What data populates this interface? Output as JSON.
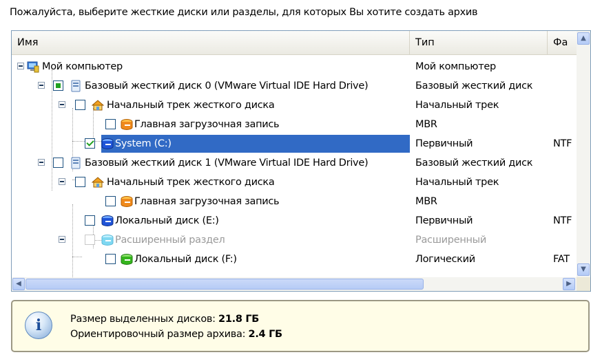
{
  "prompt": "Пожалуйста, выберите жесткие диски или разделы, для которых Вы хотите создать архив",
  "columns": {
    "name": "Имя",
    "type": "Тип",
    "fs": "Фа"
  },
  "rows": [
    {
      "label": "Мой компьютер",
      "type": "Мой компьютер",
      "fs": "",
      "icon": "computer-icon"
    },
    {
      "label": "Базовый жесткий диск 0 (VMware Virtual IDE Hard Drive)",
      "type": "Базовый жесткий диск",
      "fs": "",
      "icon": "hard-disk-icon"
    },
    {
      "label": "Начальный трек жесткого диска",
      "type": "Начальный трек",
      "fs": "",
      "icon": "track-icon"
    },
    {
      "label": "Главная загрузочная запись",
      "type": "MBR",
      "fs": "",
      "icon": "mbr-icon"
    },
    {
      "label": "System (C:)",
      "type": "Первичный",
      "fs": "NTF",
      "icon": "partition-icon"
    },
    {
      "label": "Базовый жесткий диск 1 (VMware Virtual IDE Hard Drive)",
      "type": "Базовый жесткий диск",
      "fs": "",
      "icon": "hard-disk-icon"
    },
    {
      "label": "Начальный трек жесткого диска",
      "type": "Начальный трек",
      "fs": "",
      "icon": "track-icon"
    },
    {
      "label": "Главная загрузочная запись",
      "type": "MBR",
      "fs": "",
      "icon": "mbr-icon"
    },
    {
      "label": "Локальный диск (E:)",
      "type": "Первичный",
      "fs": "NTF",
      "icon": "partition-icon"
    },
    {
      "label": "Расширенный раздел",
      "type": "Расширенный",
      "fs": "",
      "icon": "extended-partition-icon"
    },
    {
      "label": "Локальный диск (F:)",
      "type": "Логический",
      "fs": "FAT",
      "icon": "logical-partition-icon"
    }
  ],
  "info": {
    "selected_label": "Размер выделенных дисков:",
    "selected_value": "21.8 ГБ",
    "archive_label": "Ориентировочный размер архива:",
    "archive_value": "2.4 ГБ"
  },
  "colors": {
    "selection": "#316ac5",
    "check": "#21a121",
    "info_bg": "#fffde7"
  }
}
